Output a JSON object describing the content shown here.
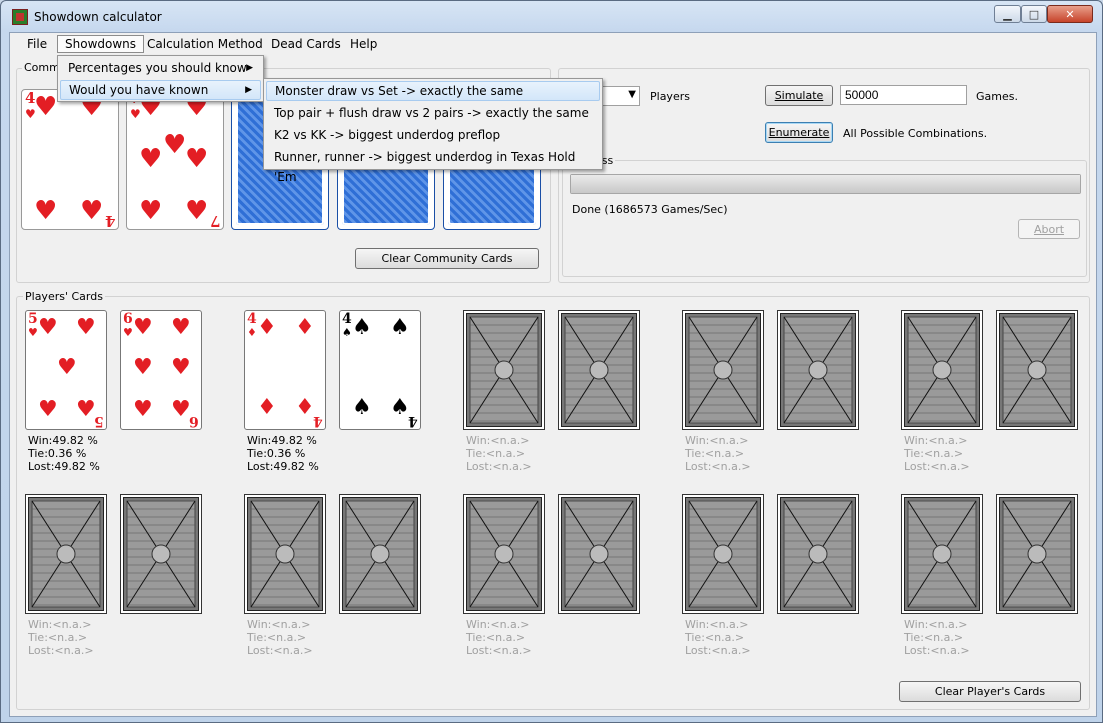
{
  "window": {
    "title": "Showdown calculator"
  },
  "menu": {
    "file": "File",
    "showdowns": "Showdowns",
    "calc_method": "Calculation Method",
    "dead_cards": "Dead Cards",
    "help": "Help"
  },
  "showdowns_menu": {
    "item1": "Percentages you should know",
    "item2": "Would you have known"
  },
  "submenu": [
    "Monster draw vs Set -> exactly the same",
    "Top pair + flush draw vs 2 pairs  -> exactly the same",
    "K2 vs KK -> biggest underdog preflop",
    "Runner, runner -> biggest underdog in Texas Hold 'Em"
  ],
  "community": {
    "label": "Community Cards",
    "label_visible": "Commu",
    "clear_button": "Clear Community Cards",
    "cards": [
      {
        "rank": "4",
        "suit": "♥",
        "color": "#e31e24"
      },
      {
        "rank": "7",
        "suit": "♥",
        "color": "#e31e24"
      }
    ]
  },
  "controls": {
    "players_label": "Players",
    "simulate": "Simulate",
    "games_value": "50000",
    "games_label": "Games.",
    "enumerate": "Enumerate",
    "enumerate_desc": "All Possible Combinations.",
    "progress_label_visible": "ess",
    "progress_percent": 100,
    "status": "Done (1686573 Games/Sec)",
    "abort": "Abort"
  },
  "players": {
    "label": "Players' Cards",
    "clear_button": "Clear Player's Cards",
    "p1": {
      "cards": [
        {
          "rank": "5",
          "suit": "♥"
        },
        {
          "rank": "6",
          "suit": "♥"
        }
      ],
      "win": "Win:49.82 %",
      "tie": "Tie:0.36 %",
      "lost": "Lost:49.82 %"
    },
    "p2": {
      "cards": [
        {
          "rank": "4",
          "suit": "♦"
        },
        {
          "rank": "4",
          "suit": "♠"
        }
      ],
      "win": "Win:49.82 %",
      "tie": "Tie:0.36 %",
      "lost": "Lost:49.82 %"
    },
    "empty": {
      "win": "Win:<n.a.>",
      "tie": "Tie:<n.a.>",
      "lost": "Lost:<n.a.>"
    }
  }
}
